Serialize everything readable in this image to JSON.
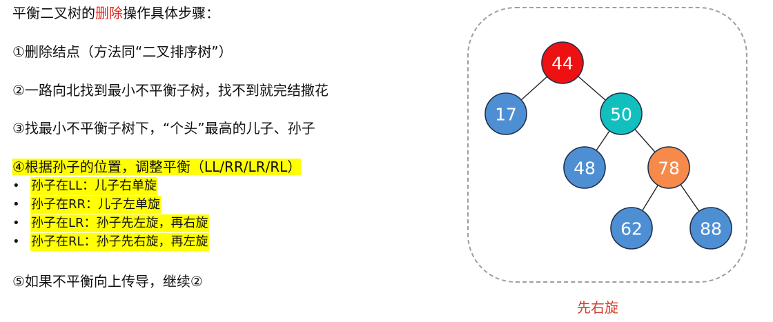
{
  "heading": {
    "prefix": "平衡二叉树的",
    "highlight": "删除",
    "suffix": "操作具体步骤："
  },
  "steps": {
    "step1": "①删除结点（方法同“二叉排序树”）",
    "step2": "②一路向北找到最小不平衡子树，找不到就完结撒花",
    "step3": "③找最小不平衡子树下，“个头”最高的儿子、孙子",
    "step4": "④根据孙子的位置，调整平衡（LL/RR/LR/RL）",
    "step5": "⑤如果不平衡向上传导，继续②"
  },
  "bullets": [
    "孙子在LL：儿子右单旋",
    "孙子在RR：儿子左单旋",
    "孙子在LR：孙子先左旋，再右旋",
    "孙子在RL：孙子先右旋，再左旋"
  ],
  "bullet_char": "•",
  "tree": {
    "nodes": [
      {
        "id": "n44",
        "label": "44",
        "color": "#ee1111"
      },
      {
        "id": "n17",
        "label": "17",
        "color": "#4e8fd4"
      },
      {
        "id": "n50",
        "label": "50",
        "color": "#12bfbf"
      },
      {
        "id": "n48",
        "label": "48",
        "color": "#4e8fd4"
      },
      {
        "id": "n78",
        "label": "78",
        "color": "#f58a4b"
      },
      {
        "id": "n62",
        "label": "62",
        "color": "#4e8fd4"
      },
      {
        "id": "n88",
        "label": "88",
        "color": "#4e8fd4"
      }
    ],
    "edges": [
      [
        "n44",
        "n17"
      ],
      [
        "n44",
        "n50"
      ],
      [
        "n50",
        "n48"
      ],
      [
        "n50",
        "n78"
      ],
      [
        "n78",
        "n62"
      ],
      [
        "n78",
        "n88"
      ]
    ]
  },
  "caption": "先右旋",
  "colors": {
    "highlight_bg": "#ffff00",
    "red_text": "#e8261c",
    "caption": "#d33d2b",
    "panel_border": "#9e9e9e"
  }
}
